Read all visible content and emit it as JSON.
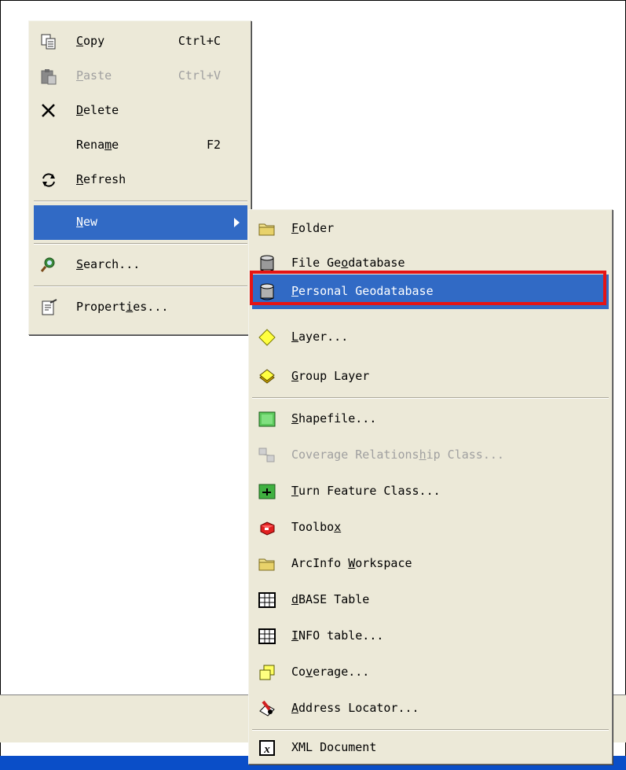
{
  "context_menu": {
    "items": [
      {
        "label": "Copy",
        "mnemonic": "C",
        "shortcut": "Ctrl+C",
        "icon": "copy-icon",
        "disabled": false
      },
      {
        "label": "Paste",
        "mnemonic": "P",
        "shortcut": "Ctrl+V",
        "icon": "paste-icon",
        "disabled": true
      },
      {
        "label": "Delete",
        "mnemonic": "D",
        "shortcut": "",
        "icon": "delete-x-icon",
        "disabled": false
      },
      {
        "label": "Rename",
        "mnemonic": "m",
        "shortcut": "F2",
        "icon": "",
        "disabled": false
      },
      {
        "label": "Refresh",
        "mnemonic": "R",
        "shortcut": "",
        "icon": "refresh-icon",
        "disabled": false
      },
      {
        "label": "New",
        "mnemonic": "N",
        "shortcut": "",
        "icon": "",
        "disabled": false,
        "highlighted": true,
        "has_submenu": true
      },
      {
        "label": "Search...",
        "mnemonic": "S",
        "shortcut": "",
        "icon": "search-icon",
        "disabled": false
      },
      {
        "label": "Properties...",
        "mnemonic": "i",
        "shortcut": "",
        "icon": "properties-icon",
        "disabled": false
      }
    ]
  },
  "new_submenu": {
    "items": [
      {
        "label": "Folder",
        "mnemonic": "F",
        "icon": "folder-icon",
        "disabled": false
      },
      {
        "label": "File Geodatabase",
        "mnemonic": "o",
        "icon": "database-icon",
        "disabled": false
      },
      {
        "label": "Personal Geodatabase",
        "mnemonic": "P",
        "icon": "database-icon",
        "disabled": false,
        "highlighted": true
      },
      {
        "label": "Layer...",
        "mnemonic": "L",
        "icon": "layer-icon",
        "disabled": false
      },
      {
        "label": "Group Layer",
        "mnemonic": "G",
        "icon": "group-layer-icon",
        "disabled": false
      },
      {
        "label": "Shapefile...",
        "mnemonic": "S",
        "icon": "shapefile-icon",
        "disabled": false
      },
      {
        "label": "Coverage Relationship Class...",
        "mnemonic": "h",
        "icon": "relationship-class-icon",
        "disabled": true
      },
      {
        "label": "Turn Feature Class...",
        "mnemonic": "T",
        "icon": "turn-feature-class-icon",
        "disabled": false
      },
      {
        "label": "Toolbox",
        "mnemonic": "x",
        "icon": "toolbox-icon",
        "disabled": false
      },
      {
        "label": "ArcInfo Workspace",
        "mnemonic": "W",
        "icon": "folder-icon",
        "disabled": false
      },
      {
        "label": "dBASE Table",
        "mnemonic": "d",
        "icon": "table-icon",
        "disabled": false
      },
      {
        "label": "INFO table...",
        "mnemonic": "I",
        "icon": "table-icon",
        "disabled": false
      },
      {
        "label": "Coverage...",
        "mnemonic": "v",
        "icon": "coverage-icon",
        "disabled": false
      },
      {
        "label": "Address Locator...",
        "mnemonic": "A",
        "icon": "address-locator-icon",
        "disabled": false
      },
      {
        "label": "XML Document",
        "mnemonic": "",
        "icon": "xml-document-icon",
        "disabled": false
      }
    ]
  },
  "colors": {
    "menu_bg": "#ece9d8",
    "highlight": "#316ac5",
    "callout": "#e51414"
  }
}
